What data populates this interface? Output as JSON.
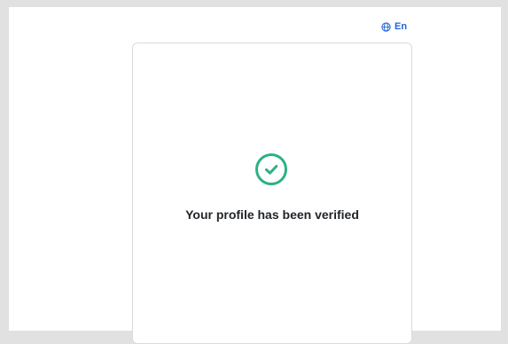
{
  "language": {
    "label": "En",
    "icon": "globe-icon"
  },
  "status": {
    "icon": "check-circle-icon",
    "message": "Your profile has been verified"
  },
  "colors": {
    "accent": "#2266d8",
    "success": "#2eb086",
    "card_border": "#d9dbe0",
    "text": "#222529",
    "background": "#e1e1e1"
  }
}
